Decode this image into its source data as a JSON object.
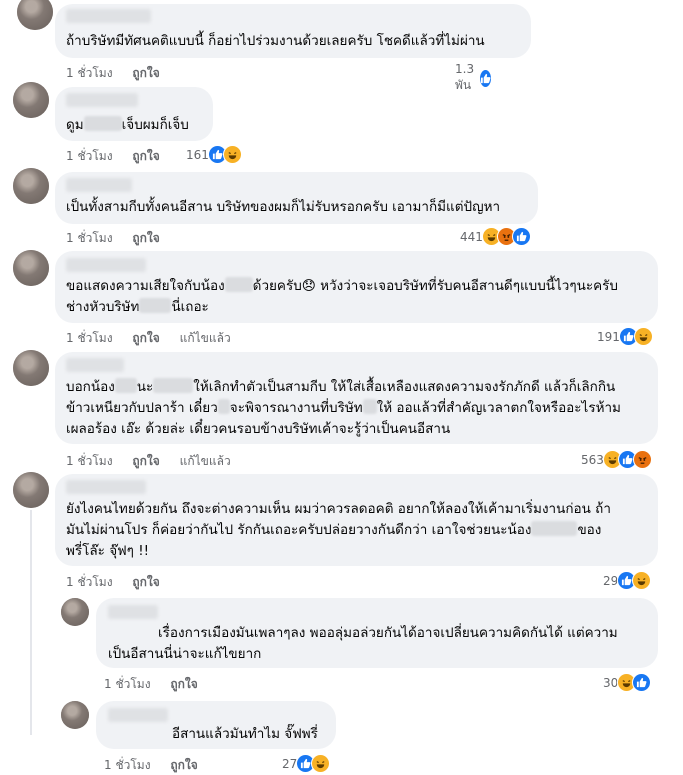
{
  "comments": [
    {
      "text_lines": [
        "ถ้าบริษัทมีทัศนคติแบบนี้ ก็อย่าไปร่วมงานด้วยเลยครับ โชคดีแล้วที่ไม่ผ่าน"
      ],
      "time": "1 ชั่วโมง",
      "like": "ถูกใจ",
      "edited": "",
      "reaction_count": "1.3 พัน",
      "reactions": [
        "like-icon"
      ]
    },
    {
      "text_pre": "ดูม",
      "text_post": "เจ็บผมก็เจ็บ",
      "time": "1 ชั่วโมง",
      "like": "ถูกใจ",
      "edited": "",
      "reaction_count": "161",
      "reactions": [
        "like-icon",
        "haha-icon"
      ]
    },
    {
      "text_lines": [
        "เป็นทั้งสามกีบทั้งคนอีสาน บริษัทของผมก็ไม่รับหรอกครับ เอามาก็มีแต่ปัญหา"
      ],
      "time": "1 ชั่วโมง",
      "like": "ถูกใจ",
      "edited": "",
      "reaction_count": "441",
      "reactions": [
        "haha-icon",
        "angry-icon",
        "like-icon"
      ]
    },
    {
      "line1_pre": "ขอแสดงความเสียใจกับน้อง",
      "line1_post": "ด้วยครับ😞 หวังว่าจะเจอบริษัทที่รับคนอีสานดีๆแบบนี้ไวๆนะครับ",
      "line2_pre": "ช่างหัวบริษัท",
      "line2_post": "นี่เถอะ",
      "time": "1 ชั่วโมง",
      "like": "ถูกใจ",
      "edited": "แก้ไขแล้ว",
      "reaction_count": "191",
      "reactions": [
        "like-icon",
        "haha-icon"
      ]
    },
    {
      "line1_a": "บอกน้อง",
      "line1_b": "นะ",
      "line1_c": "ให้เลิกทำตัวเป็นสามกีบ ให้ใส่เสื้อเหลืองแสดงความจงรักภักดี แล้วก็เลิกกิน",
      "line2_a": "ข้าวเหนียวกับปลาร้า เดี๋ยว",
      "line2_b": "จะพิจารณางานที่บริษัท",
      "line2_c": "ให้ ออแล้วที่สำคัญเวลาตกใจหรืออะไรห้าม",
      "line3": "เผลอร้อง เอ๊ะ ด้วยล่ะ เดี๋ยวคนรอบข้างบริษัทเค้าจะรู้ว่าเป็นคนอีสาน",
      "time": "1 ชั่วโมง",
      "like": "ถูกใจ",
      "edited": "แก้ไขแล้ว",
      "reaction_count": "563",
      "reactions": [
        "haha-icon",
        "like-icon",
        "angry-icon"
      ]
    },
    {
      "line1": "ยังไงคนไทยด้วยกัน ถึงจะต่างความเห็น ผมว่าควรลดอคติ อยากให้ลองให้เค้ามาเริ่มงานก่อน ถ้า",
      "line2_pre": "มันไม่ผ่านโปร ก็ค่อยว่ากันไป รักกันเถอะครับปล่อยวางกันดีกว่า เอาใจช่วยนะน้อง",
      "line2_post": "ของ",
      "line3": "พรี่โล๊ะ จุ๊ฟๆ !!",
      "time": "1 ชั่วโมง",
      "like": "ถูกใจ",
      "edited": "",
      "reaction_count": "29",
      "reactions": [
        "like-icon",
        "haha-icon"
      ]
    }
  ],
  "replies": [
    {
      "text_lines": [
        "เรื่องการเมืองมันเพลาๆลง พออลุ่มอล่วยกันได้อาจเปลี่ยนความคิดกันได้ แต่ความ",
        "เป็นอีสานนี่น่าจะแก้ไขยาก"
      ],
      "time": "1 ชั่วโมง",
      "like": "ถูกใจ",
      "reaction_count": "30",
      "reactions": [
        "haha-icon",
        "like-icon"
      ]
    },
    {
      "text_lines": [
        "อีสานแล้วมันทำไม จั๊ฟพรี่"
      ],
      "time": "1 ชั่วโมง",
      "like": "ถูกใจ",
      "reaction_count": "27",
      "reactions": [
        "like-icon",
        "haha-icon"
      ]
    }
  ],
  "colors": {
    "like": "#1877f2",
    "haha": "#f7b125",
    "angry": "#e9710f",
    "bubble": "#f0f2f5",
    "meta": "#65676b"
  }
}
